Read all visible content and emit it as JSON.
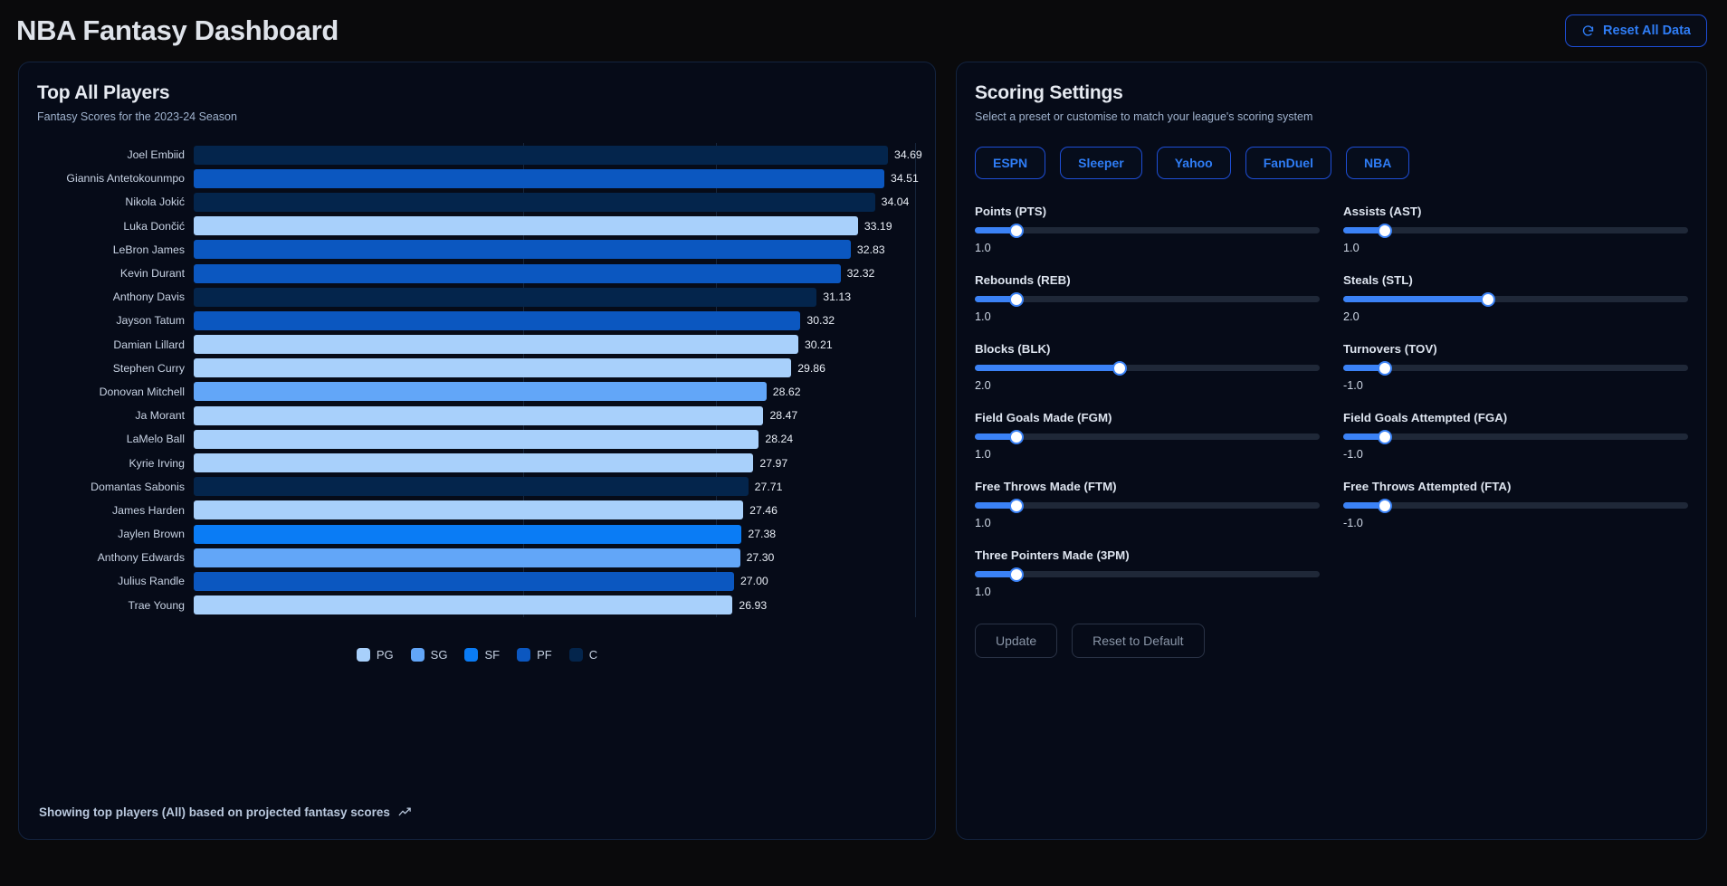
{
  "header": {
    "title": "NBA Fantasy Dashboard",
    "reset_button": "Reset All Data",
    "reset_icon": "refresh-icon"
  },
  "left_panel": {
    "title": "Top All Players",
    "subtitle": "Fantasy Scores for the 2023-24 Season",
    "footer_note": "Showing top players (All) based on projected fantasy scores",
    "footer_icon": "trend-up-icon"
  },
  "chart_data": {
    "type": "bar",
    "orientation": "horizontal",
    "title": "Top All Players",
    "subtitle": "Fantasy Scores for the 2023-24 Season",
    "xlabel": "",
    "ylabel": "",
    "xlim": [
      0,
      34.69
    ],
    "grid": true,
    "legend_position": "bottom",
    "categories": [
      "Joel Embiid",
      "Giannis Antetokounmpo",
      "Nikola Jokić",
      "Luka Dončić",
      "LeBron James",
      "Kevin Durant",
      "Anthony Davis",
      "Jayson Tatum",
      "Damian Lillard",
      "Stephen Curry",
      "Donovan Mitchell",
      "Ja Morant",
      "LaMelo Ball",
      "Kyrie Irving",
      "Domantas Sabonis",
      "James Harden",
      "Jaylen Brown",
      "Anthony Edwards",
      "Julius Randle",
      "Trae Young"
    ],
    "values": [
      34.69,
      34.51,
      34.04,
      33.19,
      32.83,
      32.32,
      31.13,
      30.32,
      30.21,
      29.86,
      28.62,
      28.47,
      28.24,
      27.97,
      27.71,
      27.46,
      27.38,
      27.3,
      27.0,
      26.93
    ],
    "value_labels": [
      "34.69",
      "34.51",
      "34.04",
      "33.19",
      "32.83",
      "32.32",
      "31.13",
      "30.32",
      "30.21",
      "29.86",
      "28.62",
      "28.47",
      "28.24",
      "27.97",
      "27.71",
      "27.46",
      "27.38",
      "27.30",
      "27.00",
      "26.93"
    ],
    "positions": [
      "C",
      "PF",
      "C",
      "PG",
      "PF",
      "PF",
      "C",
      "PF",
      "PG",
      "PG",
      "SG",
      "PG",
      "PG",
      "PG",
      "C",
      "PG",
      "SF",
      "SG",
      "PF",
      "PG"
    ],
    "legend": [
      {
        "label": "PG",
        "color": "#a8d0fb"
      },
      {
        "label": "SG",
        "color": "#62a6f8"
      },
      {
        "label": "SF",
        "color": "#0a7cf5"
      },
      {
        "label": "PF",
        "color": "#0b57c0"
      },
      {
        "label": "C",
        "color": "#04254c"
      }
    ],
    "position_colors": {
      "PG": "#a8d0fb",
      "SG": "#62a6f8",
      "SF": "#0a7cf5",
      "PF": "#0b57c0",
      "C": "#04254c"
    }
  },
  "right_panel": {
    "title": "Scoring Settings",
    "subtitle": "Select a preset or customise to match your league's scoring system",
    "presets": [
      "ESPN",
      "Sleeper",
      "Yahoo",
      "FanDuel",
      "NBA"
    ],
    "sliders": [
      {
        "label": "Points (PTS)",
        "value": "1.0",
        "percent": 12
      },
      {
        "label": "Assists (AST)",
        "value": "1.0",
        "percent": 12
      },
      {
        "label": "Rebounds (REB)",
        "value": "1.0",
        "percent": 12
      },
      {
        "label": "Steals (STL)",
        "value": "2.0",
        "percent": 42
      },
      {
        "label": "Blocks (BLK)",
        "value": "2.0",
        "percent": 42
      },
      {
        "label": "Turnovers (TOV)",
        "value": "-1.0",
        "percent": 12
      },
      {
        "label": "Field Goals Made (FGM)",
        "value": "1.0",
        "percent": 12
      },
      {
        "label": "Field Goals Attempted (FGA)",
        "value": "-1.0",
        "percent": 12
      },
      {
        "label": "Free Throws Made (FTM)",
        "value": "1.0",
        "percent": 12
      },
      {
        "label": "Free Throws Attempted (FTA)",
        "value": "-1.0",
        "percent": 12
      },
      {
        "label": "Three Pointers Made (3PM)",
        "value": "1.0",
        "percent": 12
      }
    ],
    "update_button": "Update",
    "reset_default_button": "Reset to Default"
  },
  "colors": {
    "accent": "#2f7df6",
    "panel_bg": "#060b18",
    "page_bg": "#0a0a0c",
    "slider_fill": "#3b82f6"
  }
}
